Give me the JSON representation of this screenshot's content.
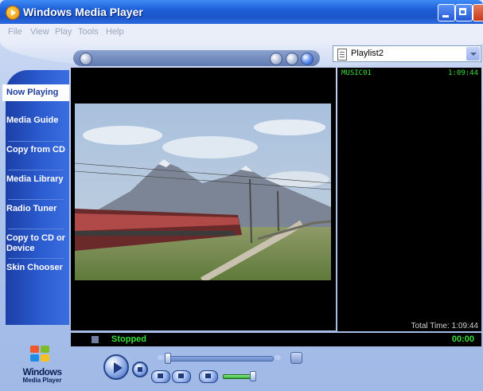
{
  "window": {
    "title": "Windows Media Player"
  },
  "menu": [
    "File",
    "View",
    "Play",
    "Tools",
    "Help"
  ],
  "taskbar": {
    "items": [
      {
        "label": "Now Playing",
        "active": true
      },
      {
        "label": "Media Guide",
        "active": false
      },
      {
        "label": "Copy from CD",
        "active": false
      },
      {
        "label": "Media Library",
        "active": false
      },
      {
        "label": "Radio Tuner",
        "active": false
      },
      {
        "label": "Copy to CD or Device",
        "active": false
      },
      {
        "label": "Skin Chooser",
        "active": false
      }
    ]
  },
  "playlist": {
    "selected": "Playlist2",
    "items": [
      {
        "name": "MUSIC01",
        "duration": "1:09:44"
      }
    ],
    "total_time": "Total Time: 1:09:44"
  },
  "status": {
    "state": "Stopped",
    "time": "00:00"
  },
  "logo": {
    "line1": "Windows",
    "line2": "Media Player"
  },
  "colors": {
    "status_green": "#39e039",
    "taskbar_blue": "#2b5cd0",
    "title_blue": "#1e5fd8"
  }
}
